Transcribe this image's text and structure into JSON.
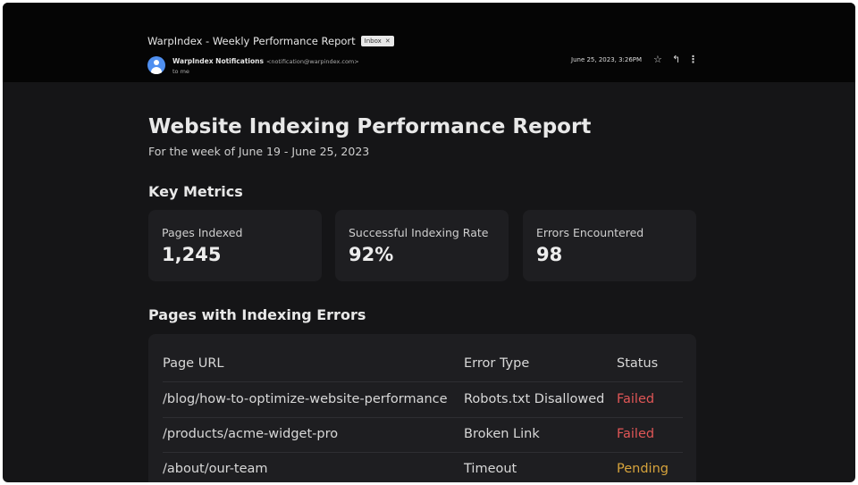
{
  "email": {
    "subject": "WarpIndex - Weekly Performance Report",
    "label": "Inbox",
    "sender_name": "WarpIndex Notifications",
    "sender_address": "<notification@warpindex.com>",
    "recipient": "to me",
    "date": "June 25, 2023, 3:26PM"
  },
  "report": {
    "title": "Website Indexing Performance Report",
    "subtitle": "For the week of June 19 - June 25, 2023",
    "metrics_heading": "Key Metrics",
    "metrics": [
      {
        "label": "Pages Indexed",
        "value": "1,245"
      },
      {
        "label": "Successful Indexing Rate",
        "value": "92%"
      },
      {
        "label": "Errors Encountered",
        "value": "98"
      }
    ],
    "errors_heading": "Pages with Indexing Errors",
    "table": {
      "headers": [
        "Page URL",
        "Error Type",
        "Status"
      ],
      "rows": [
        {
          "url": "/blog/how-to-optimize-website-performance",
          "error": "Robots.txt Disallowed",
          "status": "Failed"
        },
        {
          "url": "/products/acme-widget-pro",
          "error": "Broken Link",
          "status": "Failed"
        },
        {
          "url": "/about/our-team",
          "error": "Timeout",
          "status": "Pending"
        }
      ]
    }
  },
  "icons": {
    "star": "star-icon",
    "reply": "reply-icon",
    "more": "more-vert-icon",
    "close": "close-icon",
    "avatar": "avatar-icon"
  },
  "colors": {
    "failed": "#e05656",
    "pending": "#d6a33c",
    "avatar": "#4f8ff0"
  }
}
